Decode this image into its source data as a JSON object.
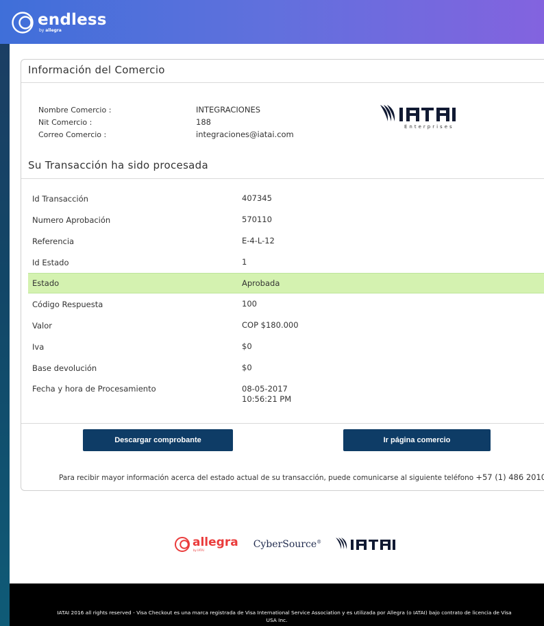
{
  "header": {
    "brand": "endless",
    "brand_sub_prefix": "by",
    "brand_sub": "allegra"
  },
  "merchant": {
    "title": "Información del Comercio",
    "rows": [
      {
        "label": "Nombre Comercio :",
        "value": "INTEGRACIONES"
      },
      {
        "label": "Nit Comercio :",
        "value": "188"
      },
      {
        "label": "Correo Comercio :",
        "value": "integraciones@iatai.com"
      }
    ],
    "logo_text": "IATAI",
    "logo_sub": "Enterprises"
  },
  "transaction": {
    "title": "Su Transacción ha sido procesada",
    "rows": [
      {
        "label": "Id Transacción",
        "value": "407345"
      },
      {
        "label": "Numero Aprobación",
        "value": "570110"
      },
      {
        "label": "Referencia",
        "value": "E-4-L-12"
      },
      {
        "label": "Id Estado",
        "value": "1"
      },
      {
        "label": "Estado",
        "value": "Aprobada"
      },
      {
        "label": "Código Respuesta",
        "value": "100"
      },
      {
        "label": "Valor",
        "value": "COP $180.000"
      },
      {
        "label": "Iva",
        "value": "$0"
      },
      {
        "label": "Base devolución",
        "value": "$0"
      },
      {
        "label": "Fecha y hora de Procesamiento",
        "value": "08-05-2017 10:56:21 PM"
      }
    ]
  },
  "buttons": {
    "download": "Descargar comprobante",
    "goto_merchant": "Ir página comercio"
  },
  "info": {
    "text": "Para recibir mayor información acerca del estado actual de su transacción, puede comunicarse al siguiente teléfono",
    "phone": "+57 (1) 486 2010."
  },
  "partners": {
    "allegra": "allegra",
    "allegra_sub": "by IATAI",
    "cybersource": "CyberSource",
    "cybersource_mark": "®",
    "iatai": "IATAI"
  },
  "footer": {
    "line1": "IATAI 2016 all rights reserved - Visa Checkout es una marca registrada de Visa International Service Association y es utilizada por Allegra (o IATAI) bajo contrato de licencia de Visa",
    "line2": "USA Inc."
  },
  "colors": {
    "header_start": "#3f6fd9",
    "header_end": "#8363df",
    "button": "#0e3c66",
    "approved_row": "#d4f2b0",
    "allegra_red": "#ea3b3b"
  }
}
